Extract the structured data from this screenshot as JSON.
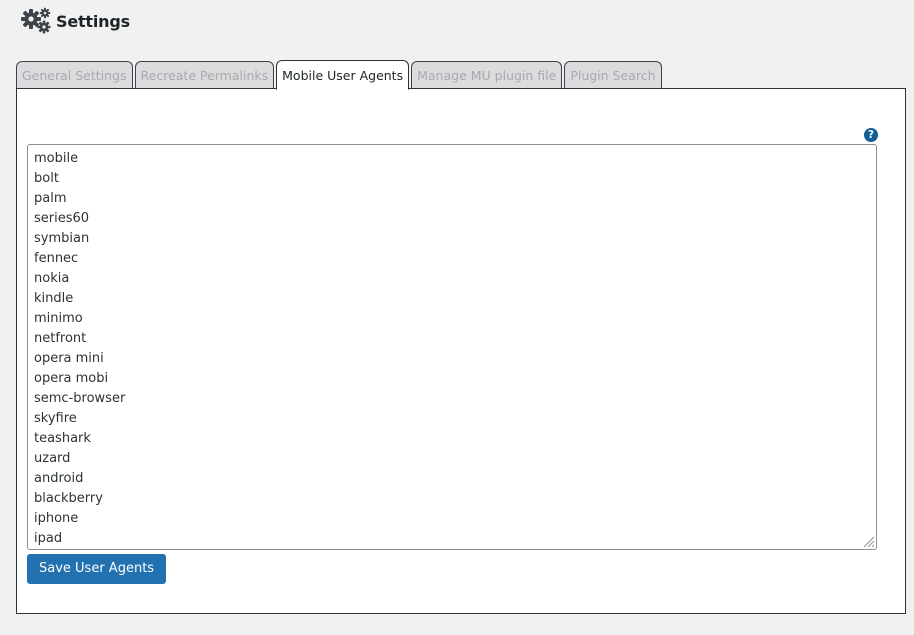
{
  "header": {
    "title": "Settings",
    "icon": "gears-icon"
  },
  "tabs": [
    {
      "label": "General Settings",
      "active": false
    },
    {
      "label": "Recreate Permalinks",
      "active": false
    },
    {
      "label": "Mobile User Agents",
      "active": true
    },
    {
      "label": "Manage MU plugin file",
      "active": false
    },
    {
      "label": "Plugin Search",
      "active": false
    }
  ],
  "panel": {
    "help_icon": "?",
    "user_agents": [
      "mobile",
      "bolt",
      "palm",
      "series60",
      "symbian",
      "fennec",
      "nokia",
      "kindle",
      "minimo",
      "netfront",
      "opera mini",
      "opera mobi",
      "semc-browser",
      "skyfire",
      "teashark",
      "uzard",
      "android",
      "blackberry",
      "iphone",
      "ipad"
    ],
    "save_label": "Save User Agents"
  },
  "colors": {
    "accent": "#2271b1",
    "help": "#135e96",
    "background": "#f1f1f1"
  }
}
